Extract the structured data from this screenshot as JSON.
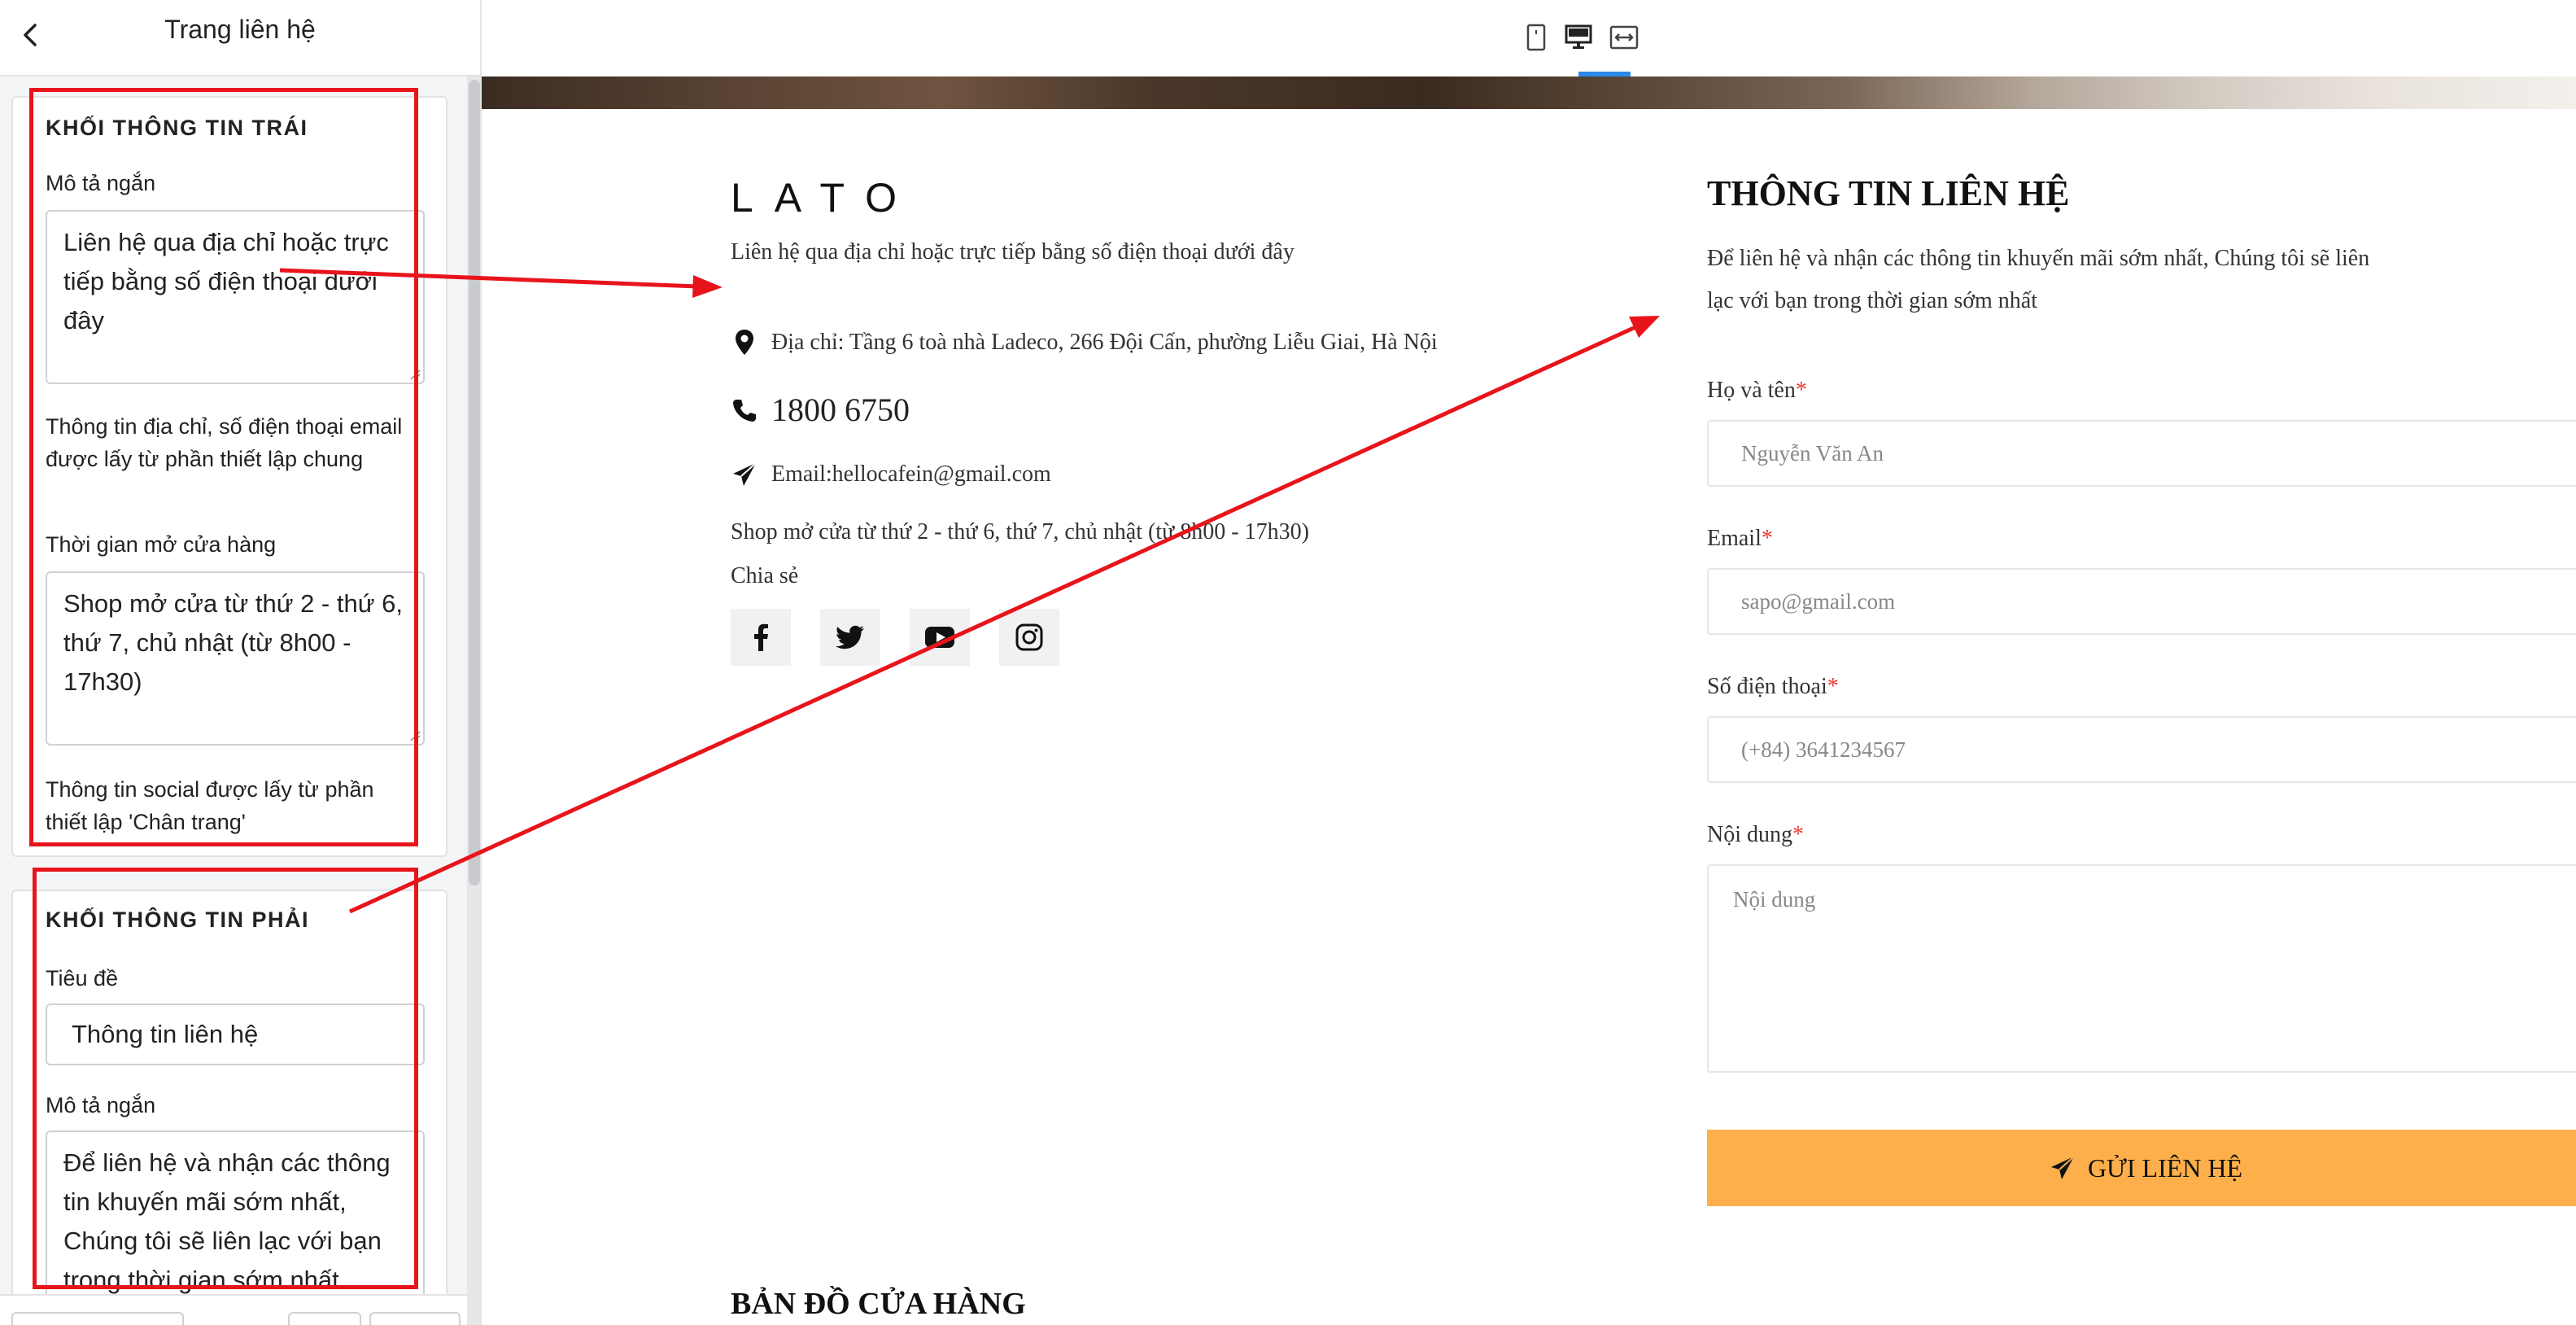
{
  "sidebar": {
    "title": "Trang liên hệ",
    "left_block": {
      "heading": "KHỐI THÔNG TIN TRÁI",
      "short_desc_label": "Mô tả ngắn",
      "short_desc_value": "Liên hệ qua địa chỉ hoặc trực tiếp bằng số điện thoại dưới đây",
      "address_note": "Thông tin địa chỉ, số điện thoại email được lấy từ phần thiết lập chung",
      "hours_label": "Thời gian mở cửa hàng",
      "hours_value": "Shop mở cửa từ thứ 2 - thứ 6, thứ 7, chủ nhật (từ 8h00 - 17h30)",
      "social_note": "Thông tin social được lấy từ phần thiết lập 'Chân trang'"
    },
    "right_block": {
      "heading": "KHỐI THÔNG TIN PHẢI",
      "title_label": "Tiêu đề",
      "title_value": "Thông tin liên hệ",
      "short_desc_label": "Mô tả ngắn",
      "short_desc_value": "Để liên hệ và nhận các thông tin khuyến mãi sớm nhất, Chúng tôi sẽ liên lạc với bạn trong thời gian sớm nhất"
    }
  },
  "toolbar": {
    "devices": [
      {
        "name": "mobile-icon"
      },
      {
        "name": "desktop-icon",
        "active": true
      },
      {
        "name": "fullwidth-icon"
      }
    ],
    "accent_color": "#2a8ae6"
  },
  "preview": {
    "logo": "LATO",
    "intro": "Liên hệ qua địa chỉ hoặc trực tiếp bằng số điện thoại dưới đây",
    "address": "Địa chỉ: Tầng 6 toà nhà Ladeco, 266 Đội Cấn, phường Liễu Giai, Hà Nội",
    "phone": "1800 6750",
    "email": "Email:hellocafein@gmail.com",
    "hours": "Shop mở cửa từ thứ 2 - thứ 6, thứ 7, chủ nhật (từ 8h00 - 17h30)",
    "share_label": "Chia sẻ",
    "socials": [
      "facebook-icon",
      "twitter-icon",
      "youtube-icon",
      "instagram-icon"
    ],
    "contact": {
      "title": "THÔNG TIN LIÊN HỆ",
      "desc_line1": "Để liên hệ và nhận các thông tin khuyến mãi sớm nhất, Chúng tôi sẽ liên",
      "desc_line2": "lạc với bạn trong thời gian sớm nhất",
      "fields": {
        "name_label": "Họ và tên",
        "name_placeholder": "Nguyễn Văn An",
        "email_label": "Email",
        "email_placeholder": "sapo@gmail.com",
        "phone_label": "Số điện thoại",
        "phone_placeholder": "(+84) 3641234567",
        "message_label": "Nội dung",
        "message_placeholder": "Nội dung",
        "required_mark": "*"
      },
      "submit_label": "GỬI LIÊN HỆ",
      "button_color": "#fdaf4c"
    },
    "map_title": "BẢN ĐỒ CỬA HÀNG"
  },
  "annotation_color": "#e8141c"
}
